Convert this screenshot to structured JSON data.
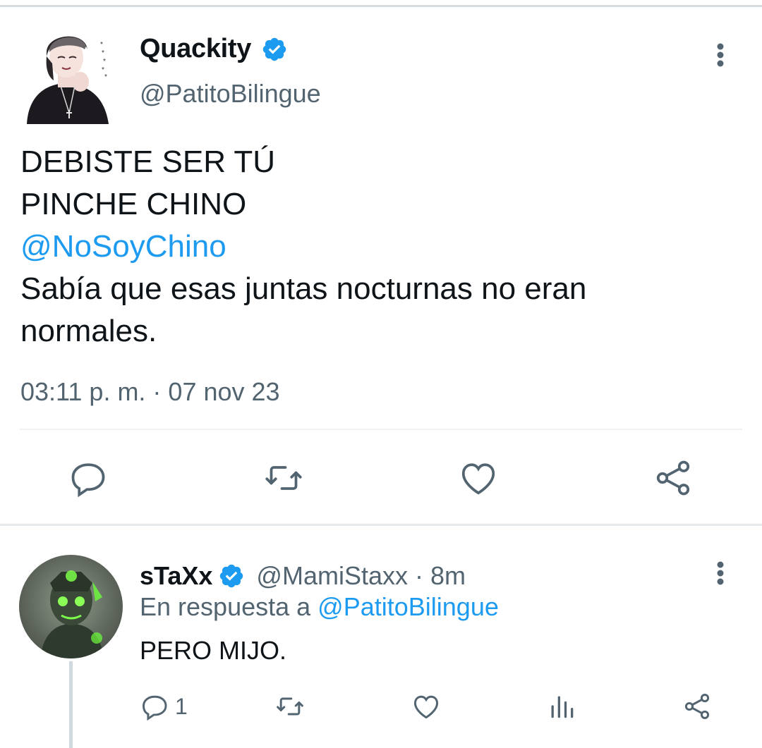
{
  "tweet": {
    "author": {
      "display_name": "Quackity",
      "handle": "@PatitoBilingue",
      "verified": true
    },
    "text_lines": [
      "DEBISTE SER TÚ",
      "PINCHE CHINO"
    ],
    "mention": "@NoSoyChino",
    "text_after": [
      "Sabía que esas juntas nocturnas no eran",
      "normales."
    ],
    "timestamp": "03:11 p. m. · 07 nov 23",
    "actions": [
      "reply-icon",
      "retweet-icon",
      "like-icon",
      "share-icon"
    ]
  },
  "reply": {
    "author": {
      "display_name": "sTaXx",
      "handle_time": "@MamiStaxx · 8m",
      "verified": true
    },
    "reply_to_prefix": "En respuesta a",
    "reply_to_handle": "@PatitoBilingue",
    "text": "PERO MIJO.",
    "reply_count": "1",
    "actions": [
      "reply-icon",
      "retweet-icon",
      "like-icon",
      "views-icon",
      "share-icon"
    ]
  },
  "colors": {
    "accent": "#1d9bf0",
    "secondary_text": "#536471",
    "primary_text": "#0f1419"
  }
}
